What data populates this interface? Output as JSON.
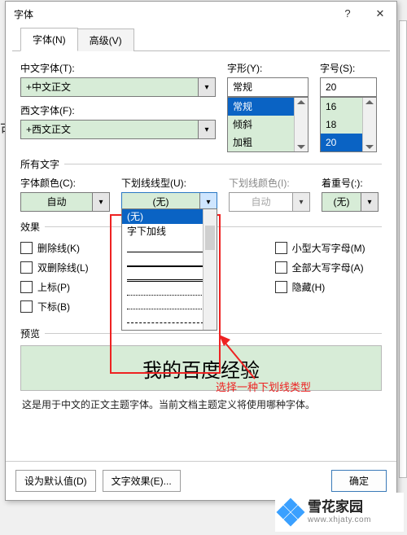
{
  "dialog": {
    "title": "字体",
    "help_icon": "?",
    "close_icon": "✕"
  },
  "tabs": {
    "font": "字体(N)",
    "advanced": "高级(V)"
  },
  "labels": {
    "cn_font": "中文字体(T):",
    "lat_font": "西文字体(F):",
    "style": "字形(Y):",
    "size": "字号(S):",
    "all_text": "所有文字",
    "font_color": "字体颜色(C):",
    "underline": "下划线线型(U):",
    "ul_color": "下划线颜色(I):",
    "emphasis": "着重号(:):",
    "effects": "效果",
    "preview": "预览"
  },
  "values": {
    "cn_font": "+中文正文",
    "lat_font": "+西文正文",
    "style": "常规",
    "size": "20",
    "font_color": "自动",
    "underline": "(无)",
    "ul_color": "自动",
    "emphasis": "(无)"
  },
  "style_list": [
    "常规",
    "倾斜",
    "加粗"
  ],
  "size_list": [
    "16",
    "18",
    "20"
  ],
  "underline_list": {
    "none": "(无)",
    "word": "字下加线"
  },
  "checks": {
    "strike": "删除线(K)",
    "dstrike": "双删除线(L)",
    "sup": "上标(P)",
    "sub": "下标(B)",
    "smallcaps": "小型大写字母(M)",
    "allcaps": "全部大写字母(A)",
    "hidden": "隐藏(H)"
  },
  "preview_text": "我的百度经验",
  "hint_text": "这是用于中文的正文主题字体。当前文档主题定义将使用哪种字体。",
  "buttons": {
    "default": "设为默认值(D)",
    "text_effects": "文字效果(E)...",
    "ok": "确定"
  },
  "annotation": "选择一种下划线类型",
  "watermark": {
    "name": "雪花家园",
    "url": "www.xhjaty.com"
  },
  "cropped": "可"
}
